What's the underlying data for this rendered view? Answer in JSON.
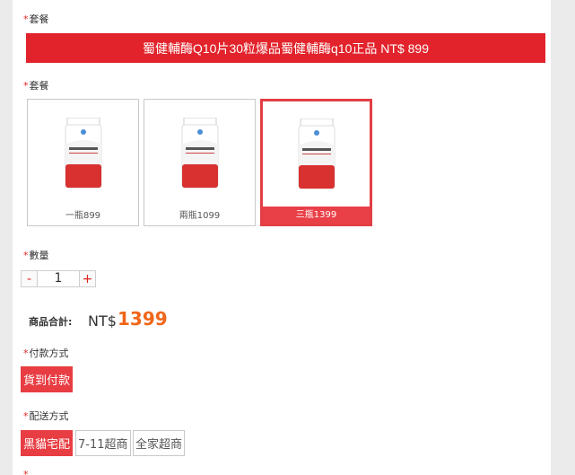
{
  "form": {
    "package_label_1": "套餐",
    "banner_text": "蜀健輔酶Q10片30粒爆品蜀健輔酶q10正品 NT$ 899",
    "package_label_2": "套餐",
    "packages": [
      {
        "name": "一瓶899",
        "selected": false
      },
      {
        "name": "兩瓶1099",
        "selected": false
      },
      {
        "name": "三瓶1399",
        "selected": true
      }
    ],
    "quantity_label": "數量",
    "quantity": {
      "minus": "-",
      "value": "1",
      "plus": "+"
    },
    "total": {
      "label": "商品合計:",
      "currency": "NT$",
      "amount": "1399"
    },
    "payment_label": "付款方式",
    "payment_options": [
      {
        "label": "貨到付款",
        "selected": true
      }
    ],
    "delivery_label": "配送方式",
    "delivery_options": [
      {
        "label": "黑貓宅配",
        "selected": true
      },
      {
        "label": "7-11超商",
        "selected": false
      },
      {
        "label": "全家超商",
        "selected": false
      }
    ],
    "required_mark": "*"
  },
  "colors": {
    "accent": "#e2232b",
    "price": "#f06518",
    "page_bg": "#ebebeb"
  }
}
